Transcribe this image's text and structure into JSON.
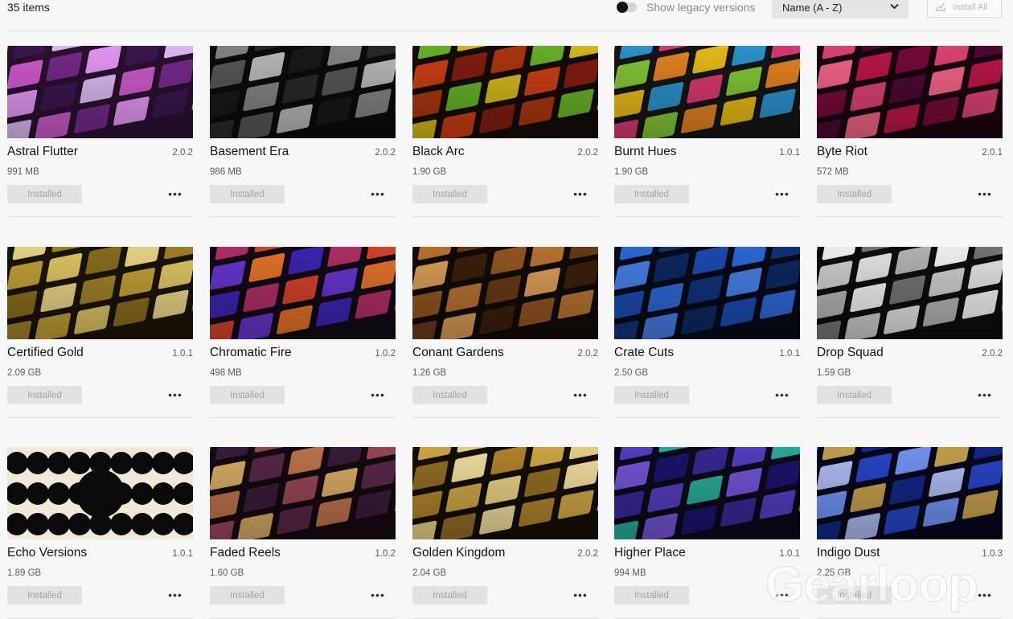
{
  "header": {
    "item_count": "35 items",
    "legacy_toggle_label": "Show legacy versions",
    "legacy_toggle_on": false,
    "sort_selected": "Name (A - Z)",
    "install_all_label": "Install All"
  },
  "watermark": "Gearloop",
  "packs": [
    {
      "name": "Astral Flutter",
      "version": "2.0.2",
      "size": "991 MB",
      "status": "Installed",
      "art": {
        "bg": "#2a1030",
        "tiles": [
          "#d75fd6",
          "#7a2b8f",
          "#f0a0ff",
          "#3b1750",
          "#e7c5ff"
        ]
      }
    },
    {
      "name": "Basement Era",
      "version": "2.0.2",
      "size": "986 MB",
      "status": "Installed",
      "art": {
        "bg": "#0b0b0b",
        "tiles": [
          "#2b2b2b",
          "#5c5c5c",
          "#c4c4c4",
          "#1a1a1a",
          "#8c8c8c"
        ]
      }
    },
    {
      "name": "Black Arc",
      "version": "2.0.2",
      "size": "1.90 GB",
      "status": "Installed",
      "art": {
        "bg": "#140c06",
        "tiles": [
          "#6dbd2a",
          "#e0c51c",
          "#d84216",
          "#8a1e12",
          "#b33a10"
        ]
      }
    },
    {
      "name": "Burnt Hues",
      "version": "1.0.1",
      "size": "1.90 GB",
      "status": "Installed",
      "art": {
        "bg": "#151515",
        "tiles": [
          "#f5c518",
          "#2c9bd6",
          "#e63b7a",
          "#8bd13a",
          "#f08a24"
        ]
      }
    },
    {
      "name": "Byte Riot",
      "version": "2.0.1",
      "size": "572 MB",
      "status": "Installed",
      "art": {
        "bg": "#1a0410",
        "tiles": [
          "#c2184a",
          "#7a0c3a",
          "#e64877",
          "#4f0a35",
          "#ff6b8e"
        ]
      }
    },
    {
      "name": "Certified Gold",
      "version": "1.0.1",
      "size": "2.09 GB",
      "status": "Installed",
      "art": {
        "bg": "#1a1404",
        "tiles": [
          "#c9a838",
          "#e9cf69",
          "#8e7220",
          "#f3e08e",
          "#a8872a"
        ]
      }
    },
    {
      "name": "Chromatic Fire",
      "version": "1.0.2",
      "size": "498 MB",
      "status": "Installed",
      "art": {
        "bg": "#120a14",
        "tiles": [
          "#e0472c",
          "#6a38d8",
          "#f07a2a",
          "#3f27b8",
          "#b8326a"
        ]
      }
    },
    {
      "name": "Conant Gardens",
      "version": "2.0.2",
      "size": "1.26 GB",
      "status": "Installed",
      "art": {
        "bg": "#120b05",
        "tiles": [
          "#c07a34",
          "#6b3e18",
          "#e6a65c",
          "#3d220c",
          "#9a5a24"
        ]
      }
    },
    {
      "name": "Crate Cuts",
      "version": "1.0.1",
      "size": "2.50 GB",
      "status": "Installed",
      "art": {
        "bg": "#050b18",
        "tiles": [
          "#1c4fb8",
          "#2f6fe0",
          "#123580",
          "#4b86f0",
          "#0d2a66"
        ]
      }
    },
    {
      "name": "Drop Squad",
      "version": "2.0.2",
      "size": "1.59 GB",
      "status": "Installed",
      "art": {
        "bg": "#0d0d0d",
        "tiles": [
          "#f0f0f0",
          "#bdbdbd",
          "#ffffff",
          "#7a7a7a",
          "#d8d8d8"
        ]
      }
    },
    {
      "name": "Echo Versions",
      "version": "1.0.1",
      "size": "1.89 GB",
      "status": "Installed",
      "art": {
        "bg": "#efe9d8",
        "tiles": [
          "#0a0a0a"
        ]
      }
    },
    {
      "name": "Faded Reels",
      "version": "1.0.2",
      "size": "1.60 GB",
      "status": "Installed",
      "art": {
        "bg": "#140a10",
        "tiles": [
          "#a04a5a",
          "#e3b56a",
          "#5a2a4a",
          "#c77a50",
          "#3a1e3a"
        ]
      }
    },
    {
      "name": "Golden Kingdom",
      "version": "2.0.2",
      "size": "2.04 GB",
      "status": "Installed",
      "art": {
        "bg": "#140e04",
        "tiles": [
          "#d9b04a",
          "#f5dc8c",
          "#9a7326",
          "#ffe9a8",
          "#b88a2e"
        ]
      }
    },
    {
      "name": "Higher Place",
      "version": "1.0.1",
      "size": "994 MB",
      "status": "Installed",
      "art": {
        "bg": "#0a0a1a",
        "tiles": [
          "#3a2a9a",
          "#5a40c8",
          "#2bb5a0",
          "#7a5ae0",
          "#1c1570"
        ]
      }
    },
    {
      "name": "Indigo Dust",
      "version": "1.0.3",
      "size": "2.25 GB",
      "status": "Installed",
      "art": {
        "bg": "#05081a",
        "tiles": [
          "#2a4ad0",
          "#7a9cff",
          "#d0a850",
          "#142a8a",
          "#b8c8ff"
        ]
      }
    }
  ]
}
